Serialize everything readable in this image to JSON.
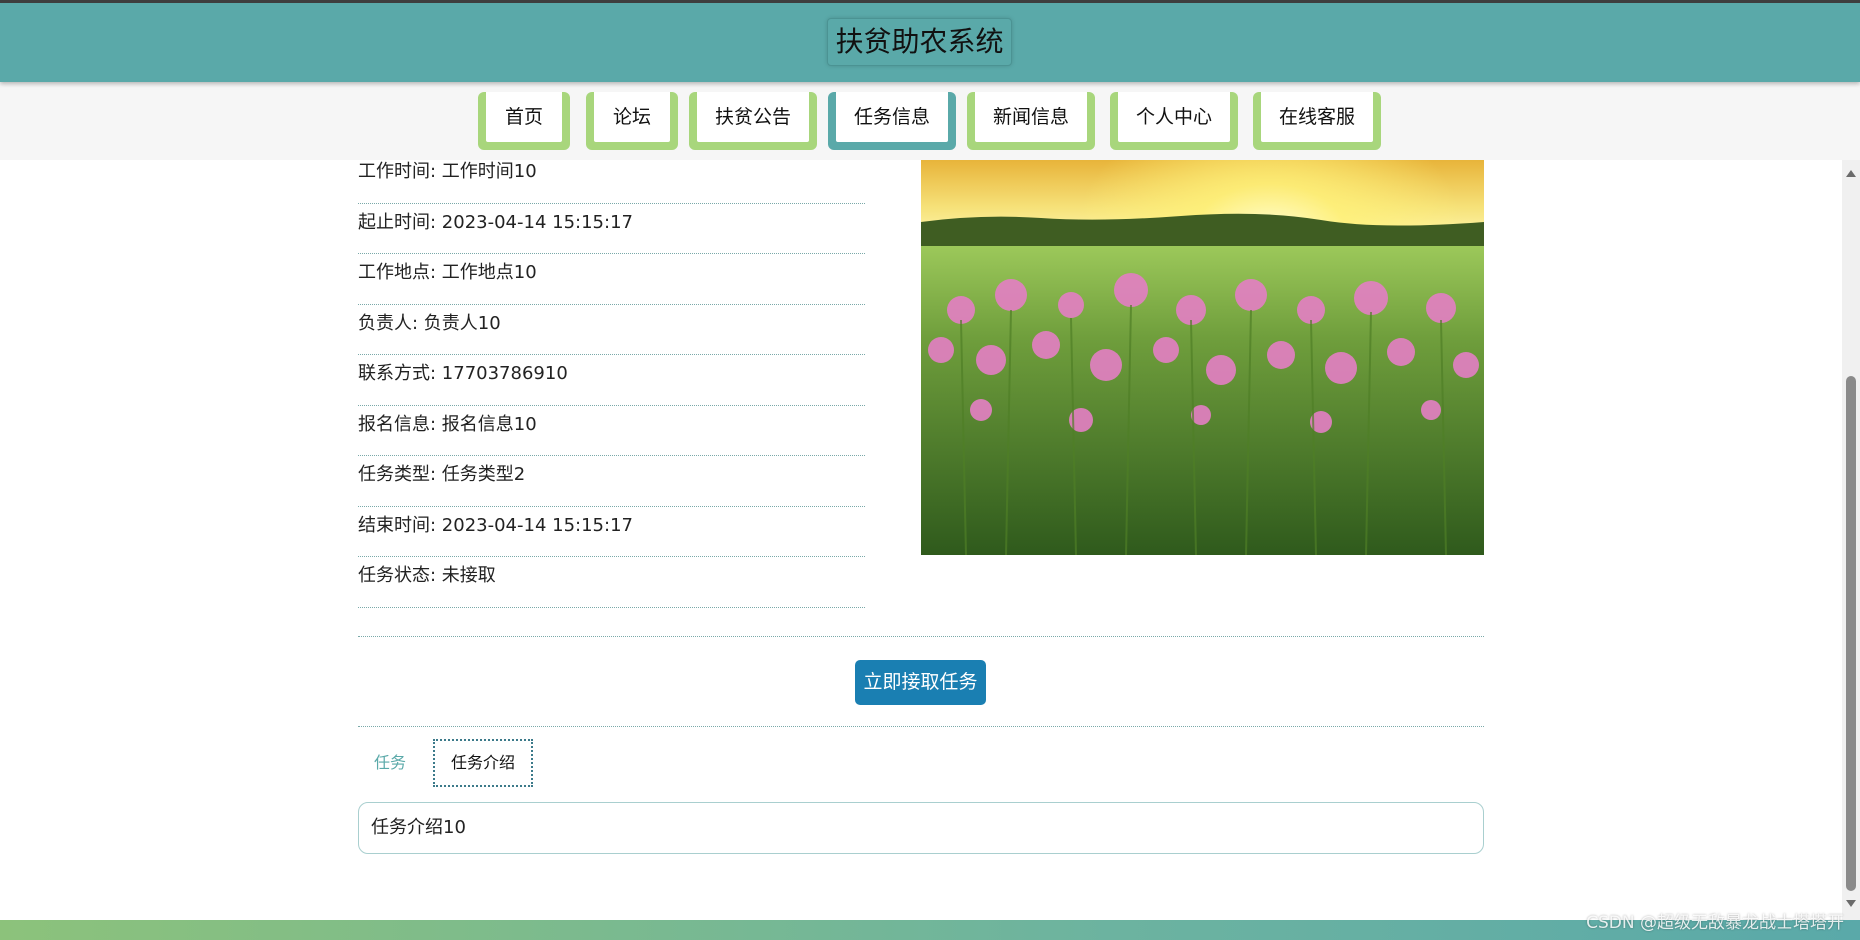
{
  "header": {
    "title": "扶贫助农系统"
  },
  "nav": {
    "tabs": [
      {
        "label": "首页",
        "active": false
      },
      {
        "label": "论坛",
        "active": false
      },
      {
        "label": "扶贫公告",
        "active": false
      },
      {
        "label": "任务信息",
        "active": true
      },
      {
        "label": "新闻信息",
        "active": false
      },
      {
        "label": "个人中心",
        "active": false
      },
      {
        "label": "在线客服",
        "active": false
      }
    ]
  },
  "detail": {
    "fields": [
      {
        "label": "工作时间",
        "value": "工作时间10"
      },
      {
        "label": "起止时间",
        "value": "2023-04-14 15:15:17"
      },
      {
        "label": "工作地点",
        "value": "工作地点10"
      },
      {
        "label": "负责人",
        "value": "负责人10"
      },
      {
        "label": "联系方式",
        "value": "17703786910"
      },
      {
        "label": "报名信息",
        "value": "报名信息10"
      },
      {
        "label": "任务类型",
        "value": "任务类型2"
      },
      {
        "label": "结束时间",
        "value": "2023-04-14 15:15:17"
      },
      {
        "label": "任务状态",
        "value": "未接取"
      }
    ],
    "accept_button": "立即接取任务"
  },
  "tabs": {
    "task_label": "任务",
    "intro_label": "任务介绍"
  },
  "intro": {
    "text": "任务介绍10"
  },
  "footer": {
    "watermark": "CSDN @超级无敌暴龙战士塔塔开"
  },
  "colors": {
    "header_bg": "#5aa9a9",
    "nav_tab": "#a8d67c",
    "nav_tab_active": "#5aa9a9",
    "accept_button": "#1a7fb2"
  }
}
